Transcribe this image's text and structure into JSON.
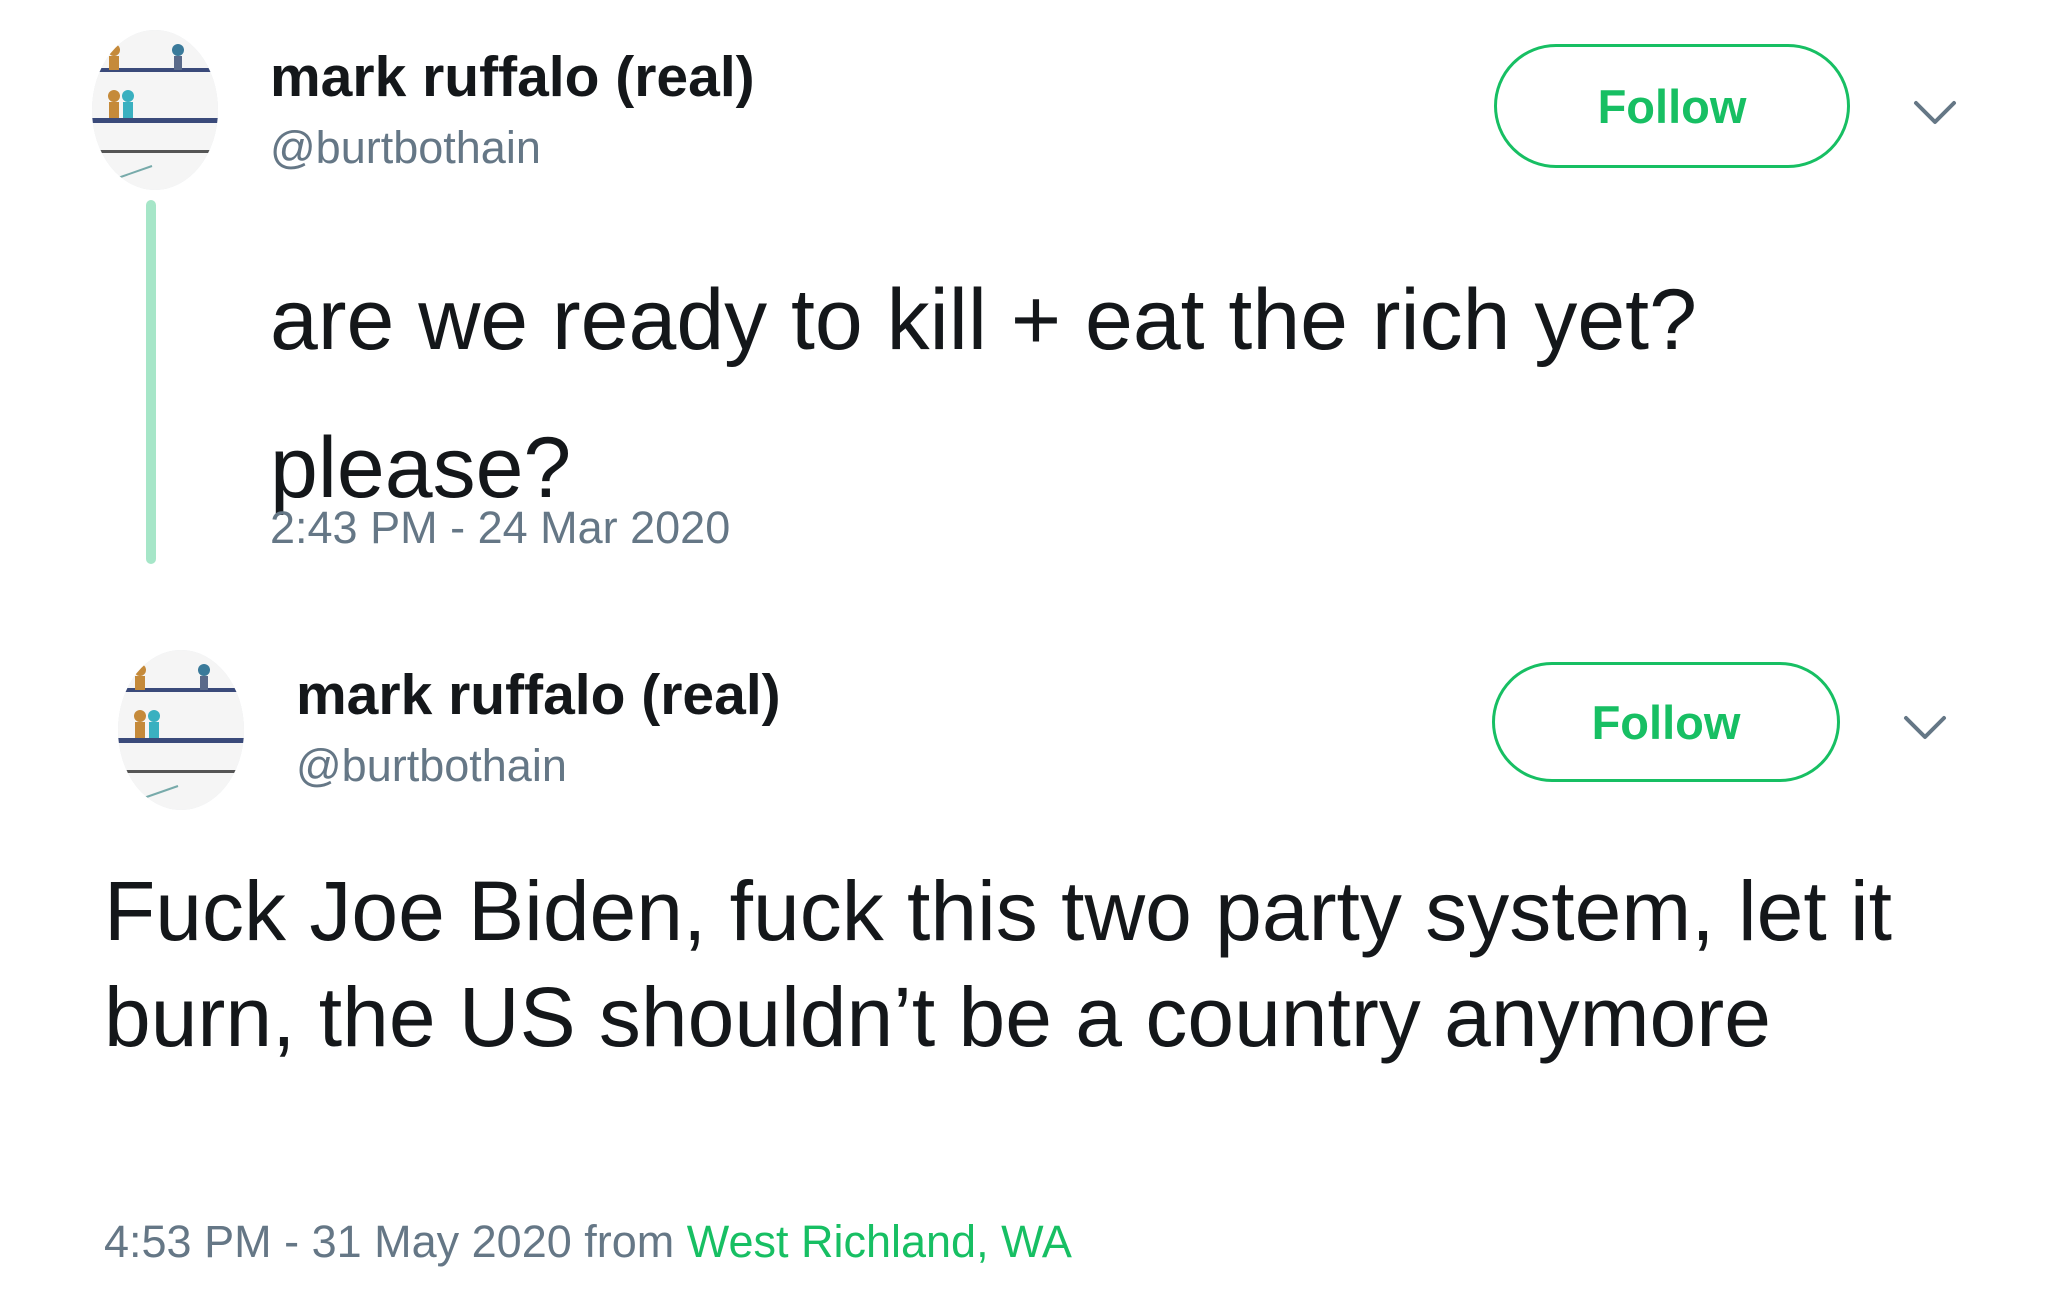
{
  "tweets": [
    {
      "display_name": "mark ruffalo (real)",
      "handle": "@burtbothain",
      "follow_label": "Follow",
      "text": "are we ready to kill + eat the rich yet? please?",
      "timestamp": "2:43 PM - 24 Mar 2020",
      "from_label": "",
      "location": ""
    },
    {
      "display_name": "mark ruffalo (real)",
      "handle": "@burtbothain",
      "follow_label": "Follow",
      "text": "Fuck Joe Biden, fuck this two party system, let it burn, the US shouldn’t be a country anymore",
      "timestamp": "4:53 PM - 31 May 2020",
      "from_label": " from ",
      "location": "West Richland, WA"
    }
  ],
  "colors": {
    "accent": "#17bf63",
    "thread_line": "#a6e6c8",
    "secondary_text": "#657786",
    "primary_text": "#14171a"
  },
  "icons": {
    "more_options": "chevron-down-icon"
  }
}
